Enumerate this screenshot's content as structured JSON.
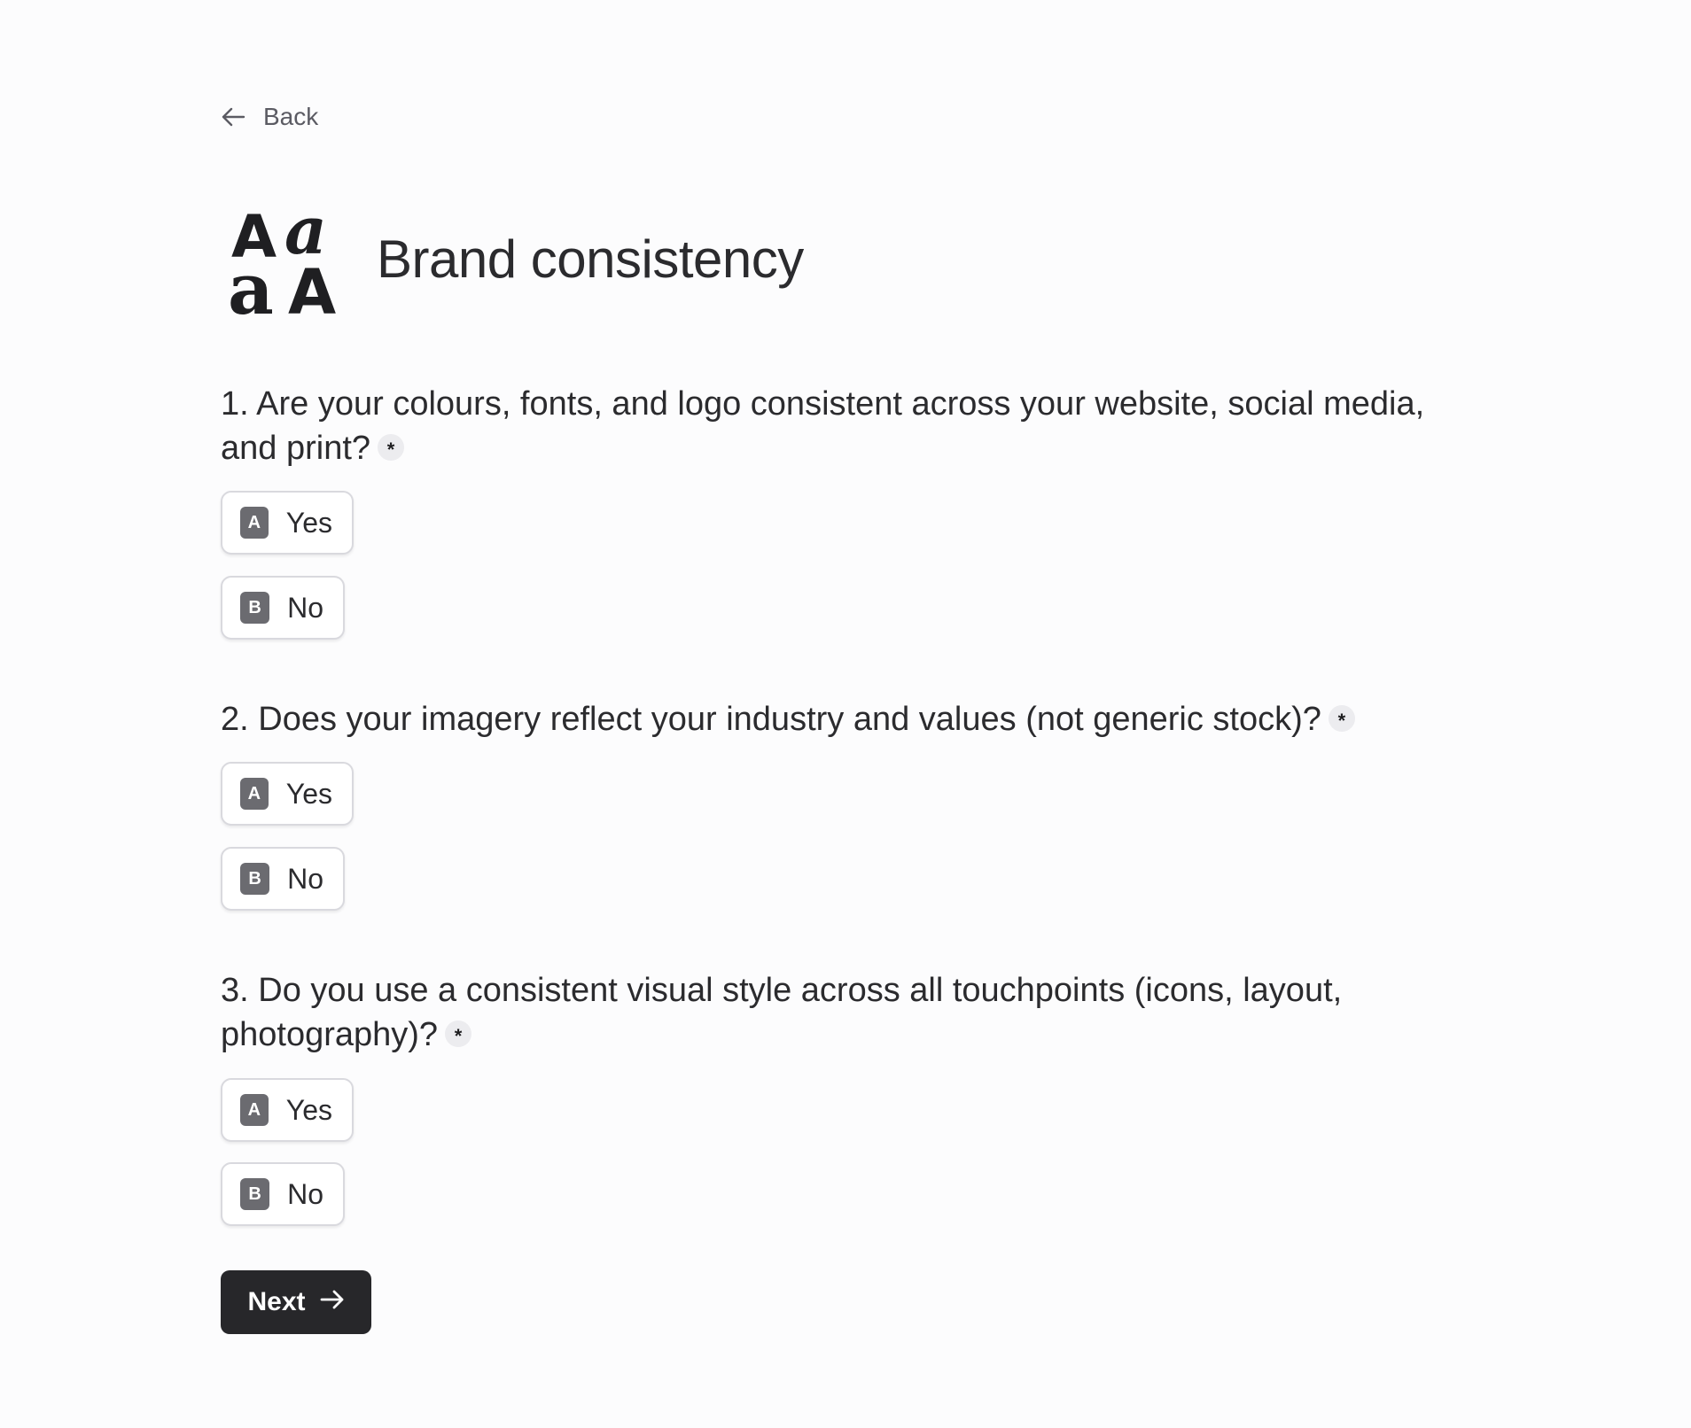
{
  "nav": {
    "back_label": "Back",
    "back_icon": "arrow-left-icon"
  },
  "header": {
    "logo_icon": "typography-aa-icon",
    "title": "Brand consistency"
  },
  "questions": [
    {
      "text": "1. Are your colours, fonts, and logo consistent across your website, social media, and print?",
      "required_mark": "*",
      "options": [
        {
          "key": "A",
          "label": "Yes"
        },
        {
          "key": "B",
          "label": "No"
        }
      ]
    },
    {
      "text": "2. Does your imagery reflect your industry and values (not generic stock)?",
      "required_mark": "*",
      "options": [
        {
          "key": "A",
          "label": "Yes"
        },
        {
          "key": "B",
          "label": "No"
        }
      ]
    },
    {
      "text": "3. Do you use a consistent visual style across all touchpoints (icons, layout, photography)?",
      "required_mark": "*",
      "options": [
        {
          "key": "A",
          "label": "Yes"
        },
        {
          "key": "B",
          "label": "No"
        }
      ]
    }
  ],
  "actions": {
    "next_label": "Next",
    "next_icon": "arrow-right-icon"
  },
  "colors": {
    "background": "#fcfcfd",
    "text": "#2b2b2e",
    "key_badge": "#6b6b70",
    "primary_button": "#27272a"
  }
}
